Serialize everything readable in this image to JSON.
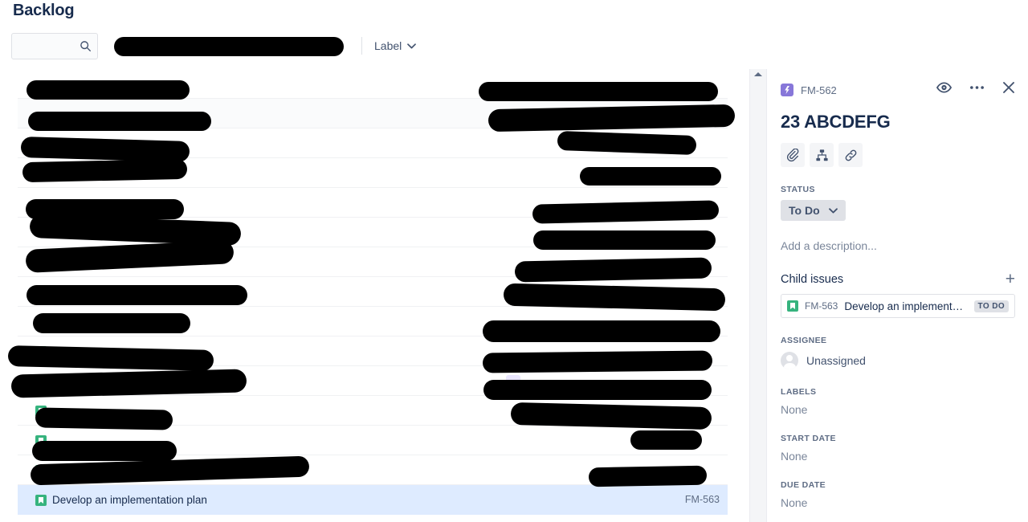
{
  "page": {
    "title": "Backlog"
  },
  "toolbar": {
    "search_placeholder": "",
    "search_value": "",
    "search_icon": "search-icon",
    "label_filter": "Label",
    "chevron_icon": "chevron-down-icon"
  },
  "backlog": {
    "rows": [
      {
        "title": "",
        "key": "",
        "icon": "",
        "redacted": true,
        "alt": false,
        "selected": false
      },
      {
        "title": "",
        "key": "",
        "icon": "",
        "redacted": true,
        "alt": true,
        "selected": false
      },
      {
        "title": "",
        "key": "",
        "icon": "story-icon",
        "redacted": true,
        "alt": false,
        "selected": false
      },
      {
        "title": "",
        "key": "",
        "icon": "",
        "redacted": true,
        "alt": false,
        "selected": false
      },
      {
        "title": "",
        "key": "",
        "icon": "",
        "redacted": true,
        "alt": false,
        "selected": false
      },
      {
        "title": "",
        "key": "",
        "icon": "",
        "redacted": true,
        "alt": false,
        "selected": false
      },
      {
        "title": "",
        "key": "",
        "icon": "",
        "redacted": true,
        "alt": false,
        "selected": false
      },
      {
        "title": "",
        "key": "",
        "icon": "",
        "redacted": true,
        "alt": false,
        "selected": false
      },
      {
        "title": "",
        "key": "",
        "icon": "",
        "redacted": true,
        "alt": false,
        "selected": false
      },
      {
        "title": "",
        "key": "",
        "icon": "story-icon",
        "redacted": true,
        "alt": false,
        "selected": false
      },
      {
        "title": "",
        "key": "",
        "icon": "story-icon",
        "redacted": true,
        "alt": false,
        "selected": false
      },
      {
        "title": "",
        "key": "",
        "icon": "story-icon",
        "redacted": true,
        "alt": false,
        "selected": false
      },
      {
        "title": "",
        "key": "",
        "icon": "story-icon",
        "redacted": true,
        "alt": false,
        "selected": false
      },
      {
        "title": "",
        "key": "",
        "icon": "story-icon",
        "redacted": true,
        "alt": false,
        "selected": false
      },
      {
        "title": "Develop an implementation plan",
        "key": "FM-563",
        "icon": "story-icon",
        "redacted": false,
        "alt": false,
        "selected": true
      }
    ]
  },
  "scrollbar": {
    "up_arrow_icon": "scroll-up-arrow-icon"
  },
  "detail": {
    "issue_key": "FM-562",
    "issue_type_icon": "epic-icon",
    "title": "23 ABCDEFG",
    "header_actions": [
      {
        "name": "watch-icon",
        "label": ""
      },
      {
        "name": "more-actions-icon",
        "label": ""
      },
      {
        "name": "close-icon",
        "label": ""
      }
    ],
    "quick_actions": [
      {
        "name": "attach-icon",
        "label": ""
      },
      {
        "name": "child-issue-icon",
        "label": ""
      },
      {
        "name": "link-icon",
        "label": ""
      }
    ],
    "status_field_label": "STATUS",
    "status_value": "To Do",
    "description_placeholder": "Add a description...",
    "child_issues": {
      "heading": "Child issues",
      "add_label": "+",
      "items": [
        {
          "key": "FM-563",
          "title": "Develop an implementation pl...",
          "status": "TO DO"
        }
      ]
    },
    "assignee_label": "ASSIGNEE",
    "assignee_value": "Unassigned",
    "labels_label": "LABELS",
    "labels_value": "None",
    "start_date_label": "START DATE",
    "start_date_value": "None",
    "due_date_label": "DUE DATE",
    "due_date_value": "None"
  },
  "colors": {
    "accent": "#0052cc",
    "selected_row": "#deebff",
    "story_green": "#36b37e",
    "epic_purple": "#8777d9",
    "text_primary": "#172b4d",
    "text_subtle": "#5e6c84"
  }
}
